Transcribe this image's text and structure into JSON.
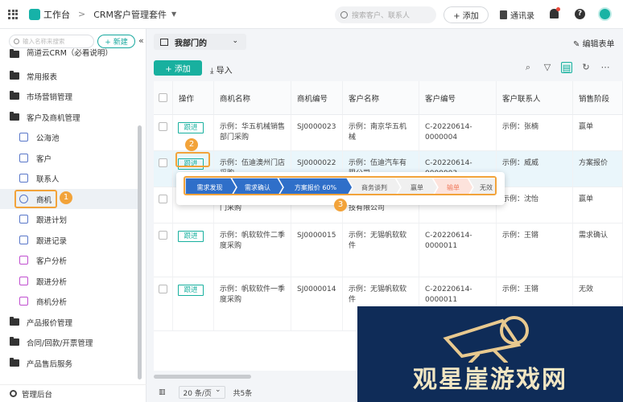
{
  "topbar": {
    "workbench": "工作台",
    "separator": ">",
    "app_name": "CRM客户管理套件",
    "search_placeholder": "搜索客户、联系人",
    "add_label": "+ 添加",
    "contacts_label": "通讯录"
  },
  "sidebar": {
    "search_placeholder": "输入名称来搜索",
    "new_label": "+ 新建",
    "collapse_icon": "«",
    "items": [
      {
        "label": "简道云CRM（必看说明）",
        "icon": "folder-icon",
        "level": 0
      },
      {
        "label": "常用报表",
        "icon": "folder-icon",
        "level": 0
      },
      {
        "label": "市场营销管理",
        "icon": "folder-icon",
        "level": 0
      },
      {
        "label": "客户及商机管理",
        "icon": "folder-icon",
        "level": 0
      },
      {
        "label": "公海池",
        "icon": "sea-pool-icon",
        "level": 1
      },
      {
        "label": "客户",
        "icon": "customer-icon",
        "level": 1
      },
      {
        "label": "联系人",
        "icon": "contact-icon",
        "level": 1
      },
      {
        "label": "商机",
        "icon": "opportunity-icon",
        "level": 1,
        "active": true
      },
      {
        "label": "跟进计划",
        "icon": "plan-icon",
        "level": 1
      },
      {
        "label": "跟进记录",
        "icon": "record-icon",
        "level": 1
      },
      {
        "label": "客户分析",
        "icon": "chart-icon",
        "level": 1
      },
      {
        "label": "跟进分析",
        "icon": "chart-icon",
        "level": 1
      },
      {
        "label": "商机分析",
        "icon": "chart-icon",
        "level": 1
      },
      {
        "label": "产品报价管理",
        "icon": "folder-icon",
        "level": 0
      },
      {
        "label": "合同/回款/开票管理",
        "icon": "folder-icon",
        "level": 0
      },
      {
        "label": "产品售后服务",
        "icon": "folder-icon",
        "level": 0
      }
    ],
    "footer": "管理后台"
  },
  "view": {
    "name": "我部门的",
    "edit_list": "编辑表单"
  },
  "toolbar": {
    "add": "+ 添加",
    "import": "导入"
  },
  "table": {
    "columns": [
      "操作",
      "商机名称",
      "商机编号",
      "客户名称",
      "客户编号",
      "客户联系人",
      "销售阶段"
    ],
    "follow_label": "跟进",
    "rows": [
      {
        "name": "示例：华五机械销售部门采购",
        "id": "SJ0000023",
        "customer": "示例：南京华五机械",
        "customer_id": "C-20220614-0000004",
        "contact": "示例：张楠",
        "stage": "赢单"
      },
      {
        "name": "示例：伍迪澳州门店采购",
        "id": "SJ0000022",
        "customer": "示例：伍迪汽车有限公司",
        "customer_id": "C-20220614-0000003",
        "contact": "示例：威威",
        "stage": "方案报价"
      },
      {
        "name": "门采购",
        "id": "",
        "customer": "技有限公司",
        "customer_id": "",
        "contact": "示例：沈怡",
        "stage": "赢单"
      },
      {
        "name": "示例：帆软软件二季度采购",
        "id": "SJ0000015",
        "customer": "示例：无锡帆软软件",
        "customer_id": "C-20220614-0000011",
        "contact": "示例：王锵",
        "stage": "需求确认"
      },
      {
        "name": "示例：帆软软件一季度采购",
        "id": "SJ0000014",
        "customer": "示例：无锡帆软软件",
        "customer_id": "C-20220614-0000011",
        "contact": "示例：王锵",
        "stage": "无效"
      }
    ]
  },
  "stage_popup": {
    "stages": [
      {
        "label": "需求发现",
        "state": "done"
      },
      {
        "label": "需求确认",
        "state": "done"
      },
      {
        "label": "方案报价 60%",
        "state": "current"
      },
      {
        "label": "商务谈判",
        "state": "todo"
      },
      {
        "label": "赢单",
        "state": "todo"
      },
      {
        "label": "输单",
        "state": "lost"
      },
      {
        "label": "无效",
        "state": "todo"
      }
    ]
  },
  "annotations": [
    "1",
    "2",
    "3"
  ],
  "pager": {
    "per_page": "20 条/页",
    "total": "共5条"
  },
  "watermark": {
    "text": "观星崖游戏网"
  },
  "colors": {
    "accent": "#18b09f",
    "highlight": "#f2a33a",
    "stage_done": "#2f6fc9",
    "stage_lost": "#f07a5c",
    "watermark_bg": "#0f2c58"
  }
}
